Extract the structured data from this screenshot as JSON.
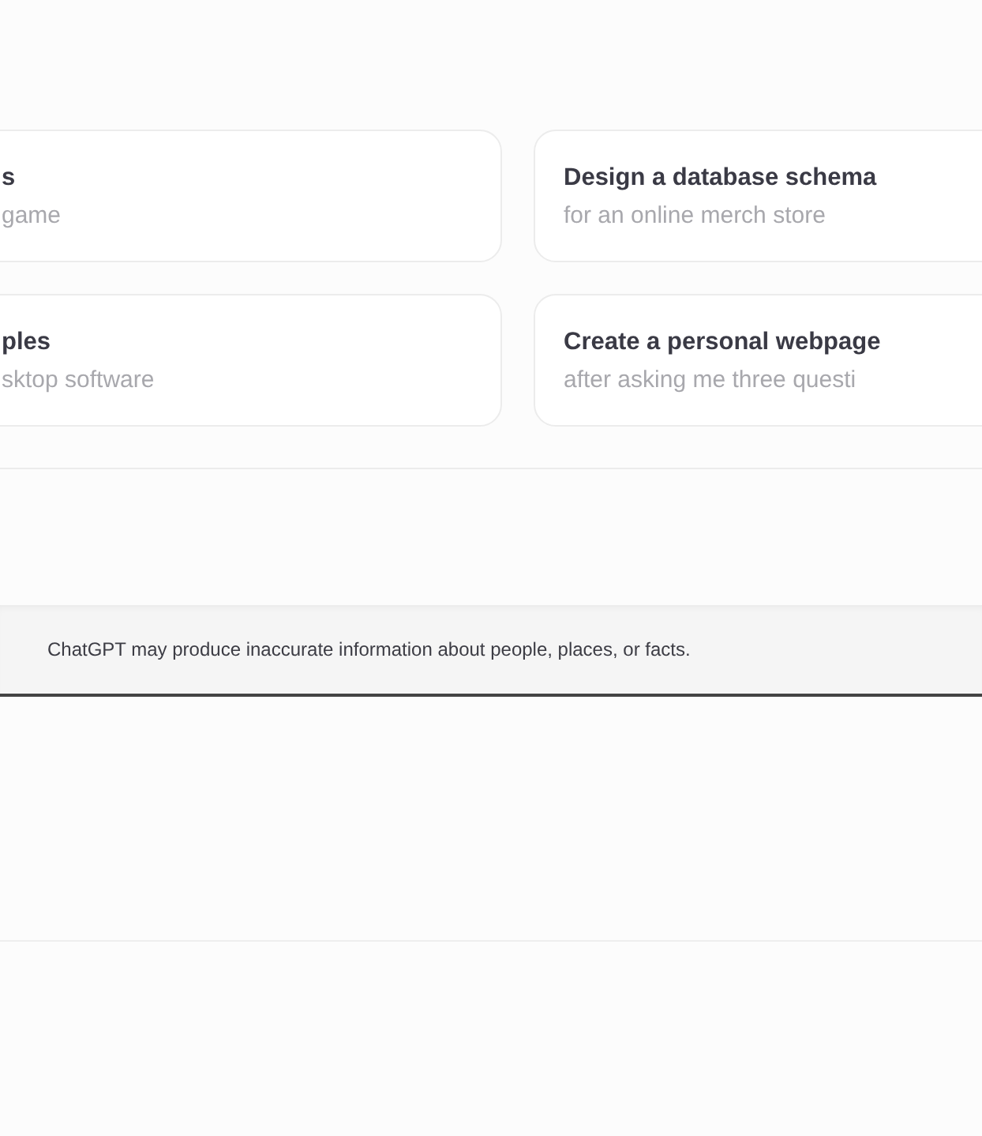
{
  "suggestions": [
    {
      "title": "s",
      "subtitle": "game"
    },
    {
      "title": "Design a database schema",
      "subtitle": "for an online merch store"
    },
    {
      "title": "ples",
      "subtitle": "sktop software"
    },
    {
      "title": "Create a personal webpage",
      "subtitle": "after asking me three questi"
    }
  ],
  "disclaimer": "ChatGPT may produce inaccurate information about people, places, or facts."
}
